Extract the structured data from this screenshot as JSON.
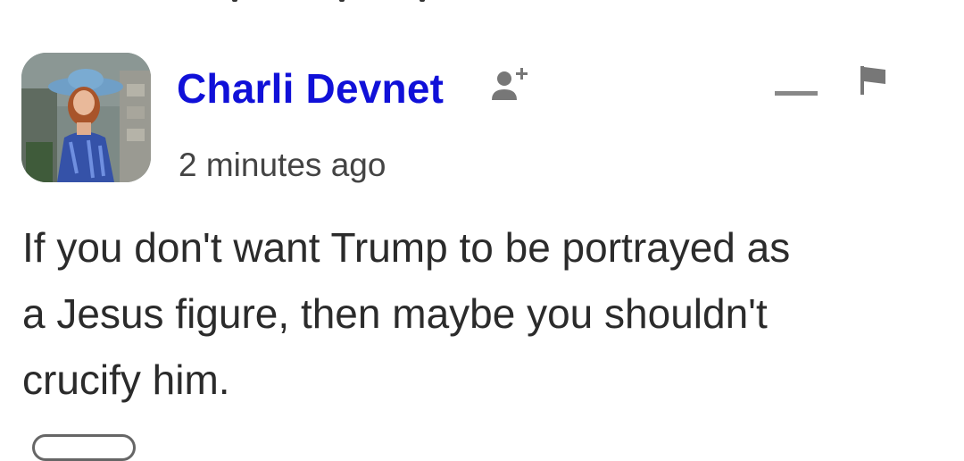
{
  "comment": {
    "author": "Charli Devnet",
    "timestamp": "2 minutes ago",
    "body_lines": [
      "If you don't want Trump to be portrayed as",
      "a Jesus figure, then maybe you shouldn't",
      "crucify him."
    ]
  },
  "icons": {
    "avatar": "profile-photo",
    "follow": "add-person-icon",
    "collapse": "minus-icon",
    "report": "flag-icon"
  },
  "colors": {
    "author_link": "#1010d8",
    "body_text": "#2b2b2b",
    "meta_text": "#444444",
    "icon_gray": "#666666"
  }
}
